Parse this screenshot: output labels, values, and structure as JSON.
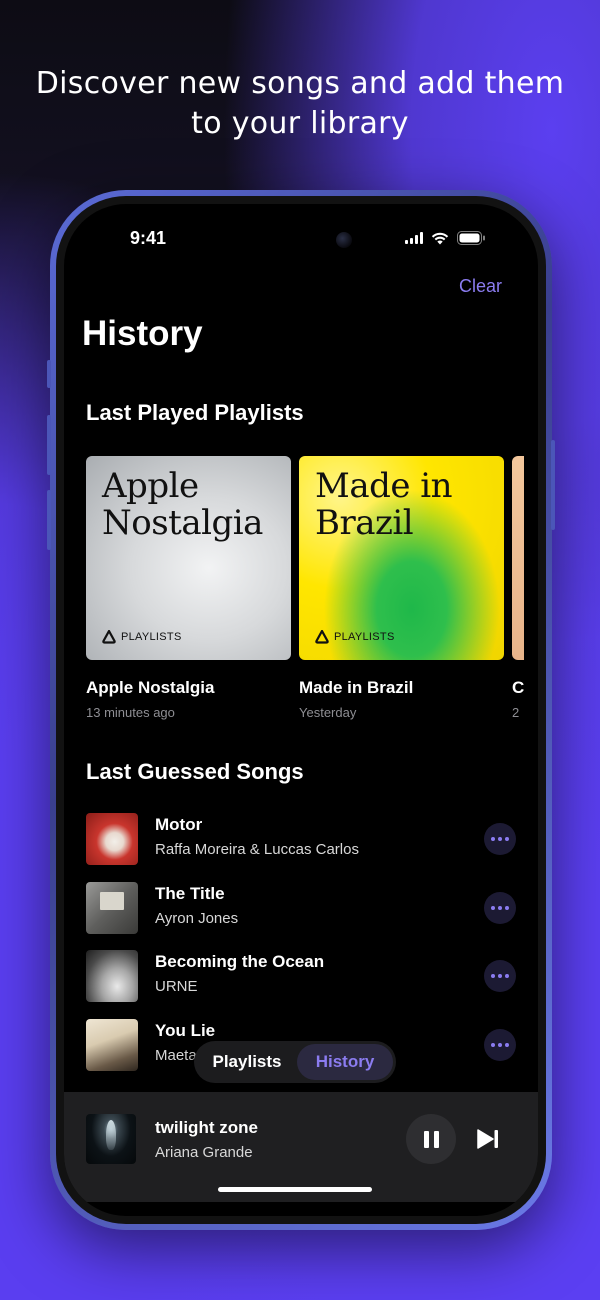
{
  "headline": {
    "line1": "Discover new songs and add them",
    "line2": "to your library"
  },
  "status_bar": {
    "time": "9:41",
    "icons": [
      "signal-icon",
      "wifi-icon",
      "battery-icon"
    ]
  },
  "header": {
    "clear_label": "Clear",
    "title": "History"
  },
  "playlists_section": {
    "title": "Last Played Playlists",
    "items": [
      {
        "art_title": "Apple Nostalgia",
        "art_line1": "Apple",
        "art_line2": "Nostalgia",
        "badge": "PLAYLISTS",
        "name": "Apple Nostalgia",
        "time": "13 minutes ago"
      },
      {
        "art_title": "Made in Brazil",
        "art_line1": "Made in",
        "art_line2": "Brazil",
        "badge": "PLAYLISTS",
        "name": "Made in Brazil",
        "time": "Yesterday"
      },
      {
        "name": "C",
        "time": "2"
      }
    ]
  },
  "songs_section": {
    "title": "Last Guessed Songs",
    "items": [
      {
        "title": "Motor",
        "artist": "Raffa Moreira & Luccas Carlos"
      },
      {
        "title": "The Title",
        "artist": "Ayron Jones"
      },
      {
        "title": "Becoming the Ocean",
        "artist": "URNE"
      },
      {
        "title": "You Lie",
        "artist": "Maeta"
      }
    ]
  },
  "tabs": {
    "playlists_label": "Playlists",
    "history_label": "History",
    "selected": "History"
  },
  "now_playing": {
    "title": "twilight zone",
    "artist": "Ariana Grande"
  },
  "colors": {
    "accent": "#8b7cf0",
    "background_purple": "#5a3ef0"
  }
}
